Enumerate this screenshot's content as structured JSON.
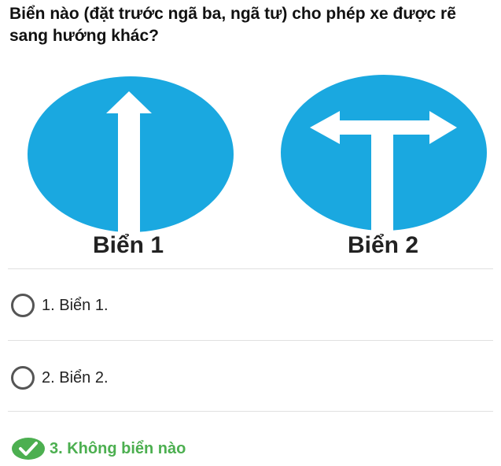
{
  "question": "Biển nào (đặt trước ngã ba, ngã tư) cho phép xe được rẽ sang hướng khác?",
  "signs": [
    {
      "label": "Biển 1",
      "icon": "straight-only-sign-icon"
    },
    {
      "label": "Biển 2",
      "icon": "turn-left-or-right-sign-icon"
    }
  ],
  "sign_color": "#1aa8e0",
  "options": [
    {
      "text": "1. Biển 1.",
      "selected": false
    },
    {
      "text": "2. Biển 2.",
      "selected": false
    },
    {
      "text": "3. Không biển nào",
      "selected": true,
      "correct": true
    }
  ],
  "correct_color": "#4caf50"
}
